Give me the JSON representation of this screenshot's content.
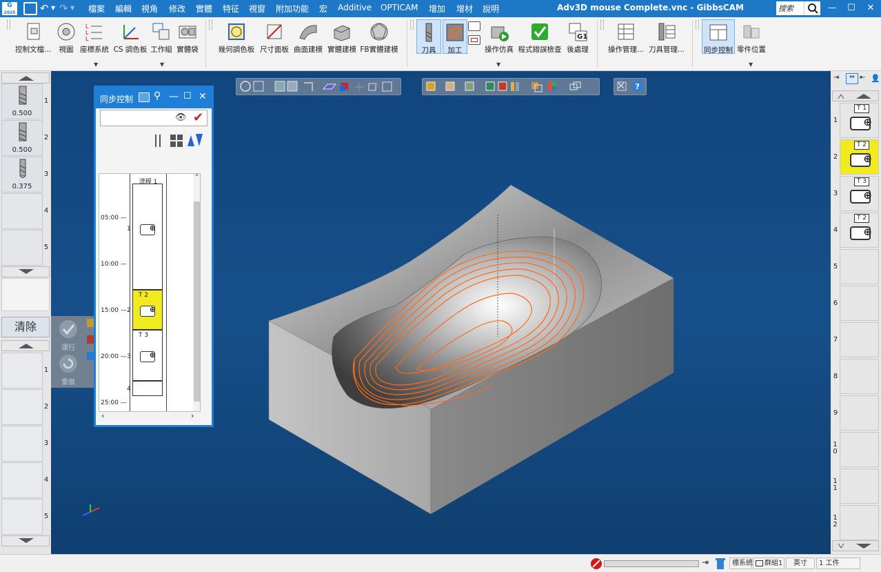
{
  "app": {
    "title": "Adv3D mouse Complete.vnc - GibbsCAM",
    "search_placeholder": "搜索"
  },
  "menu": [
    "檔案",
    "編輯",
    "視角",
    "修改",
    "實體",
    "特征",
    "視窗",
    "附加功能",
    "宏",
    "Additive",
    "OPTICAM",
    "增加",
    "增材",
    "說明"
  ],
  "ribbon": {
    "buttons": {
      "control_doc": "控制文檔...",
      "view": "視圖",
      "coord_system": "座標系統",
      "cs_palette": "CS 調色板",
      "work_group": "工作組",
      "solid_bag": "實體袋",
      "geo_palette": "幾何調色板",
      "dim_panel": "尺寸面板",
      "surface_model": "曲面建模",
      "solid_model": "實體建模",
      "fb_solid_model": "FB實體建模",
      "tools": "刀具",
      "machining": "加工",
      "op_sim": "操作仿真",
      "program_check": "程式錯誤檢查",
      "post_process": "後處理",
      "op_manager": "操作管理...",
      "tool_manager": "刀具管理...",
      "sync_control": "同步控制",
      "part_position": "零件位置"
    }
  },
  "left_panel": {
    "tools": [
      {
        "num": "1",
        "value": "0.500"
      },
      {
        "num": "2",
        "value": "0.500"
      },
      {
        "num": "3",
        "value": "0.375"
      },
      {
        "num": "4",
        "value": ""
      },
      {
        "num": "5",
        "value": ""
      }
    ],
    "clear_label": "清除",
    "run_label": "運行",
    "redo_label": "重做",
    "lower_slots": [
      "1",
      "2",
      "3",
      "4",
      "5"
    ]
  },
  "sync_window": {
    "title": "同步控制",
    "flow_label": "流程 1",
    "time_labels": [
      "05:00",
      "10:00",
      "15:00",
      "20:00",
      "25:00"
    ],
    "ops": [
      {
        "num": "1",
        "tool": ""
      },
      {
        "num": "2",
        "tool": "T 2"
      },
      {
        "num": "3",
        "tool": "T 3"
      },
      {
        "num": "4",
        "tool": ""
      }
    ]
  },
  "right_panel": {
    "slots": [
      {
        "num": "1",
        "tool": "T 1",
        "highlight": false
      },
      {
        "num": "2",
        "tool": "T 2",
        "highlight": true
      },
      {
        "num": "3",
        "tool": "T 3",
        "highlight": false
      },
      {
        "num": "4",
        "tool": "T 2",
        "highlight": false
      },
      {
        "num": "5",
        "tool": "",
        "highlight": false
      },
      {
        "num": "6",
        "tool": "",
        "highlight": false
      },
      {
        "num": "7",
        "tool": "",
        "highlight": false
      },
      {
        "num": "8",
        "tool": "",
        "highlight": false
      },
      {
        "num": "9",
        "tool": "",
        "highlight": false
      },
      {
        "num": "10",
        "tool": "",
        "highlight": false
      },
      {
        "num": "11",
        "tool": "",
        "highlight": false
      },
      {
        "num": "12",
        "tool": "",
        "highlight": false
      }
    ]
  },
  "status": {
    "coord_sys": "標系統",
    "group": "群組1",
    "unit": "英寸",
    "workpiece": "1 工件"
  },
  "colors": {
    "titlebar": "#1e78c8",
    "viewport_bg": "#164f8a",
    "toolpath": "#ff6a1a",
    "highlight_yellow": "#f0ea1e"
  }
}
